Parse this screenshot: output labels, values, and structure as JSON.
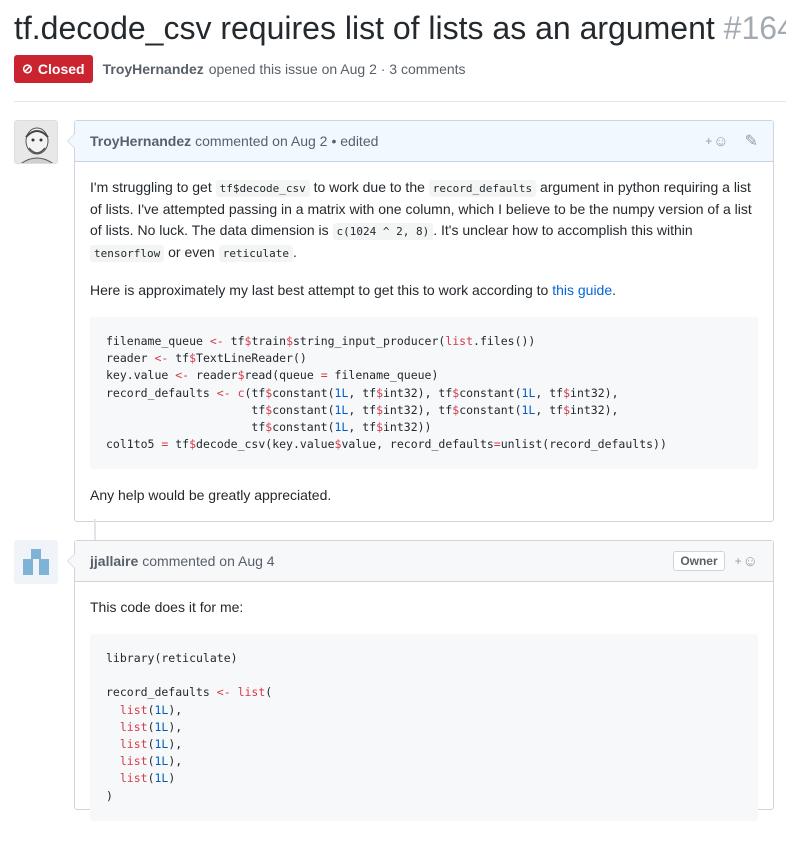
{
  "issue": {
    "title": "tf.decode_csv requires list of lists as an argument",
    "number": "#164",
    "state": "Closed",
    "author": "TroyHernandez",
    "meta_text": "opened this issue on Aug 2 · 3 comments"
  },
  "comments": [
    {
      "author": "TroyHernandez",
      "meta": "commented on Aug 2",
      "edited": "• edited",
      "body": {
        "p1": [
          "I'm struggling to get ",
          "tf$decode_csv",
          " to work due to the ",
          "record_defaults",
          " argument in python requiring a list of lists. I've attempted passing in a matrix with one column, which I believe to be the numpy version of a list of lists. No luck. The data dimension is ",
          "c(1024 ^ 2, 8)",
          ". It's unclear how to accomplish this within ",
          "tensorflow",
          " or even ",
          "reticulate",
          "."
        ],
        "p2_text": "Here is approximately my last best attempt to get this to work according to ",
        "p2_link": "this guide",
        "p2_end": ".",
        "code": [
          "filename_queue <- tf$train$string_input_producer(list.files())",
          "reader <- tf$TextLineReader()",
          "key.value <- reader$read(queue = filename_queue)",
          "record_defaults <- c(tf$constant(1L, tf$int32), tf$constant(1L, tf$int32),",
          "                     tf$constant(1L, tf$int32), tf$constant(1L, tf$int32),",
          "                     tf$constant(1L, tf$int32))",
          "col1to5 = tf$decode_csv(key.value$value, record_defaults=unlist(record_defaults))"
        ],
        "p3": "Any help would be greatly appreciated."
      }
    },
    {
      "author": "jjallaire",
      "meta": "commented on Aug 4",
      "badge": "Owner",
      "body": {
        "p1": "This code does it for me:",
        "code": [
          "library(reticulate)",
          "",
          "record_defaults <- list(",
          "  list(1L),",
          "  list(1L),",
          "  list(1L),",
          "  list(1L),",
          "  list(1L)",
          ")"
        ]
      }
    }
  ],
  "icons": {
    "closed": "closed-issue-icon",
    "reaction": "smiley-icon",
    "edit": "pencil-icon"
  },
  "colors": {
    "closed_red": "#cb2431",
    "link_blue": "#0366d6",
    "keyword_red": "#d73a49",
    "number_blue": "#005cc5"
  }
}
